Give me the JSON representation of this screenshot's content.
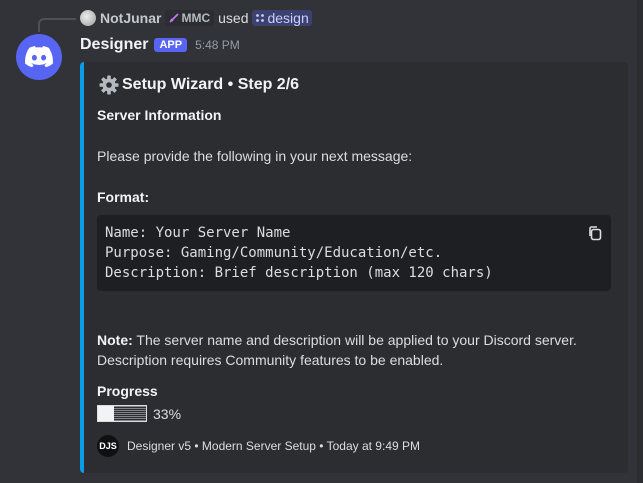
{
  "reply": {
    "username": "NotJunar",
    "tag": "MMC",
    "used_text": "used",
    "command": "design"
  },
  "message": {
    "author": "Designer",
    "badge": "APP",
    "timestamp": "5:48 PM"
  },
  "embed": {
    "accent_color": "#0c9be8",
    "title": "Setup Wizard • Step 2/6",
    "section_heading": "Server Information",
    "instruction": "Please provide the following in your next message:",
    "format_label": "Format:",
    "code_lines": [
      "Name: Your Server Name",
      "Purpose: Gaming/Community/Education/etc.",
      "Description: Brief description (max 120 chars)"
    ],
    "note_label": "Note:",
    "note_line1": " The server name and description will be applied to your Discord server.",
    "note_line2": "Description requires Community features to be enabled.",
    "progress_label": "Progress",
    "progress_value": 0.33,
    "progress_text": "33%",
    "footer_icon_text": "DJS",
    "footer_text": "Designer v5 • Modern Server Setup • Today at 9:49 PM"
  }
}
